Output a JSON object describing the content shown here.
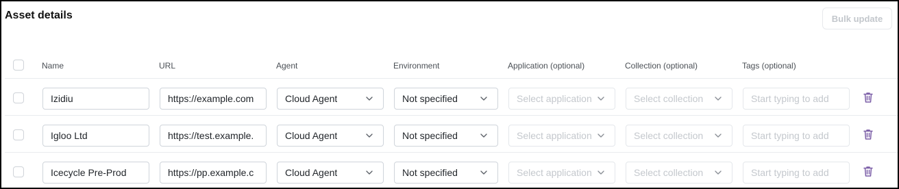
{
  "section": {
    "title": "Asset details",
    "bulk_update_label": "Bulk update"
  },
  "columns": {
    "name": "Name",
    "url": "URL",
    "agent": "Agent",
    "environment": "Environment",
    "application": "Application (optional)",
    "collection": "Collection (optional)",
    "tags": "Tags (optional)"
  },
  "placeholders": {
    "application": "Select application",
    "collection": "Select collection",
    "tags": "Start typing to add"
  },
  "rows": [
    {
      "name": "Izidiu",
      "url": "https://example.com",
      "agent": "Cloud Agent",
      "environment": "Not specified"
    },
    {
      "name": "Igloo Ltd",
      "url": "https://test.example.",
      "agent": "Cloud Agent",
      "environment": "Not specified"
    },
    {
      "name": "Icecycle Pre-Prod",
      "url": "https://pp.example.c",
      "agent": "Cloud Agent",
      "environment": "Not specified"
    }
  ],
  "icons": {
    "row_delete": "trash-icon",
    "dropdown": "chevron-down-icon"
  },
  "colors": {
    "delete_icon": "#7b5ea7",
    "border": "#cfd4da",
    "disabled_text": "#c4c8cd"
  }
}
